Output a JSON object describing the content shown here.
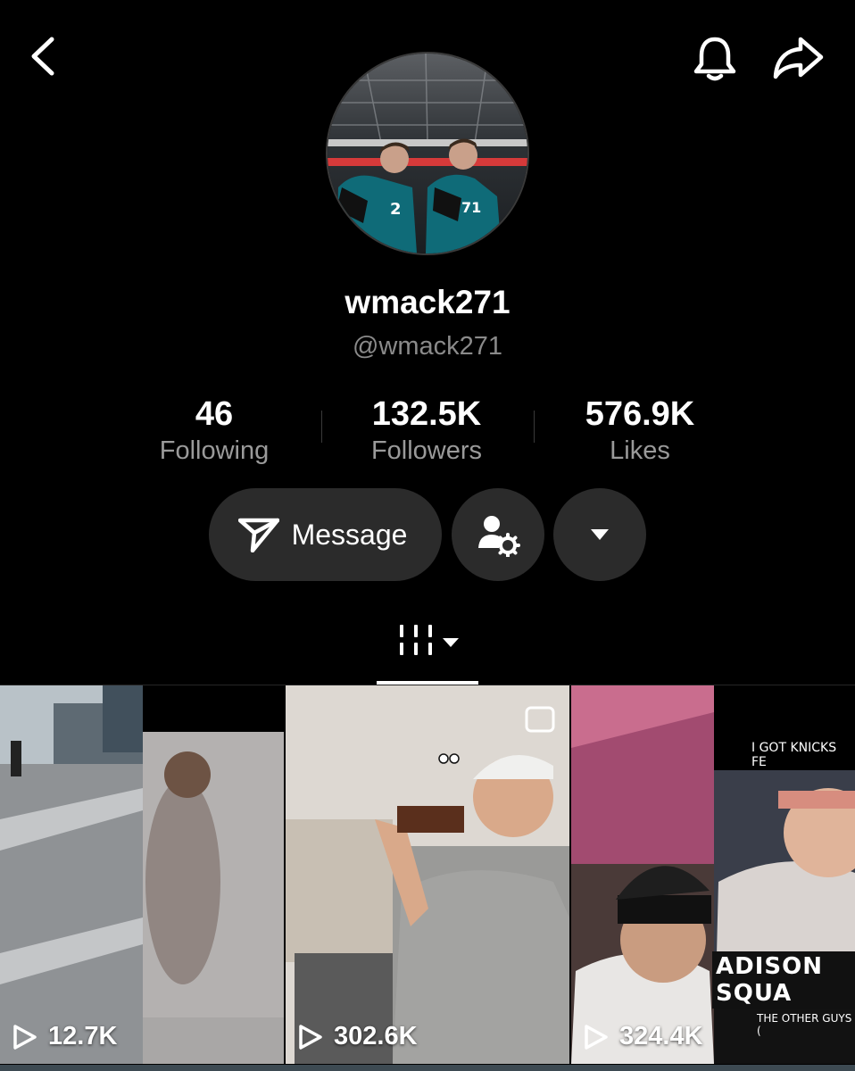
{
  "header": {
    "back_icon": "chevron-left-icon",
    "bell_icon": "bell-icon",
    "share_icon": "share-arrow-icon"
  },
  "profile": {
    "display_name": "wmack271",
    "handle": "@wmack271"
  },
  "stats": [
    {
      "value": "46",
      "label": "Following"
    },
    {
      "value": "132.5K",
      "label": "Followers"
    },
    {
      "value": "576.9K",
      "label": "Likes"
    }
  ],
  "actions": {
    "message_label": "Message",
    "message_icon": "send-icon",
    "friend_icon": "user-settings-icon",
    "more_icon": "caret-down-icon"
  },
  "tabs": {
    "grid_icon": "videos-grid-icon"
  },
  "videos": [
    {
      "views": "12.7K"
    },
    {
      "views": "302.6K"
    },
    {
      "views": "324.4K",
      "caption_top": "I GOT KNICKS FE",
      "caption_sign": "ADISON SQUA",
      "caption_bottom": "THE OTHER GUYS ("
    }
  ],
  "colors": {
    "background": "#000000",
    "button": "#2b2b2b",
    "muted_text": "#9a9a9a"
  }
}
